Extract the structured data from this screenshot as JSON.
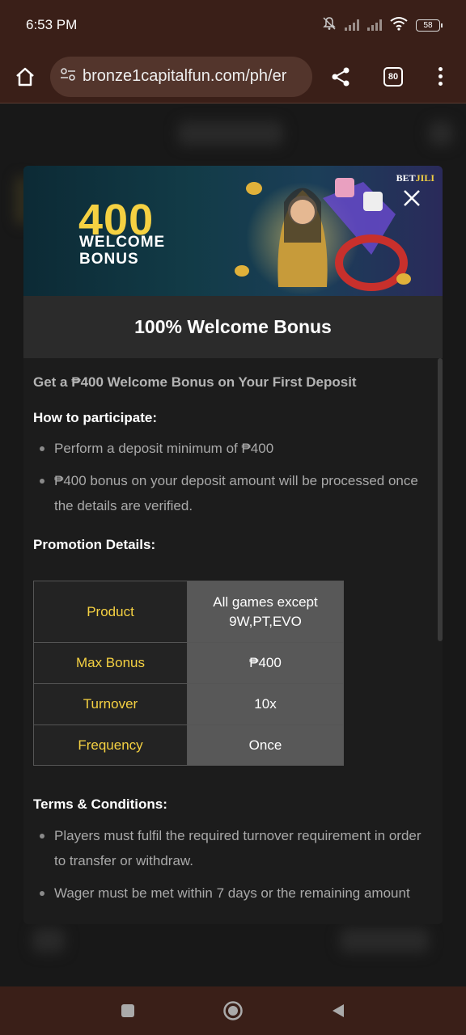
{
  "status_bar": {
    "time": "6:53 PM",
    "battery": "58"
  },
  "browser": {
    "url": "bronze1capitalfun.com/ph/er",
    "tab_count": "80"
  },
  "banner": {
    "amount": "400",
    "line1": "WELCOME",
    "line2": "BONUS",
    "brand_part1": "BET",
    "brand_part2": "JILI"
  },
  "modal": {
    "title": "100% Welcome Bonus",
    "intro": "Get a ₱400 Welcome Bonus on Your First Deposit",
    "how_title": "How to participate:",
    "how_items": [
      "Perform a deposit minimum of ₱400",
      "₱400 bonus on your deposit amount will be processed once the details are verified."
    ],
    "promo_title": "Promotion Details:",
    "promo_table": [
      {
        "label": "Product",
        "value": "All games except 9W,PT,EVO"
      },
      {
        "label": "Max Bonus",
        "value": "₱400"
      },
      {
        "label": "Turnover",
        "value": "10x"
      },
      {
        "label": "Frequency",
        "value": "Once"
      }
    ],
    "terms_title": "Terms & Conditions:",
    "terms_items": [
      "Players must fulfil the required turnover requirement in order to transfer or withdraw.",
      "Wager must be met within 7 days or the remaining amount"
    ]
  },
  "colors": {
    "accent_gold": "#f5d142",
    "browser_bar": "#3a1f18"
  }
}
